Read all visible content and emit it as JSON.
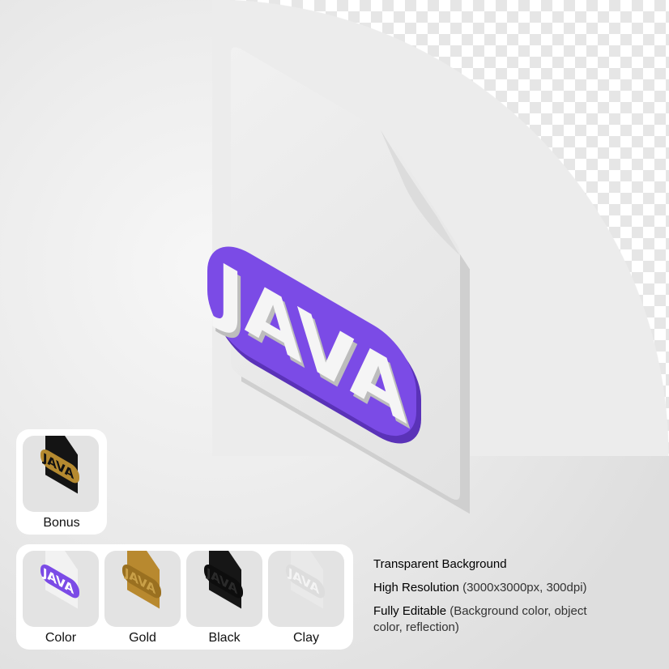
{
  "main_icon": {
    "label": "JAVA",
    "band_color": "#7b4be6",
    "paper_color": "#f0f0f0"
  },
  "bonus": {
    "label": "Bonus",
    "style": "black-gold"
  },
  "variants": [
    {
      "label": "Color",
      "paper": "#f2f2f2",
      "band": "#7b4be6",
      "text": "#ffffff"
    },
    {
      "label": "Gold",
      "paper": "#b8892f",
      "band": "#9a7020",
      "text": "#c9a048"
    },
    {
      "label": "Black",
      "paper": "#161616",
      "band": "#0d0d0d",
      "text": "#2a2a2a"
    },
    {
      "label": "Clay",
      "paper": "#e9e9e9",
      "band": "#dddddd",
      "text": "#f4f4f4"
    }
  ],
  "features": [
    {
      "title": "Transparent Background",
      "detail": ""
    },
    {
      "title": "High Resolution",
      "detail": "(3000x3000px, 300dpi)"
    },
    {
      "title": "Fully Editable",
      "detail": "(Background color, object color, reflection)"
    }
  ]
}
